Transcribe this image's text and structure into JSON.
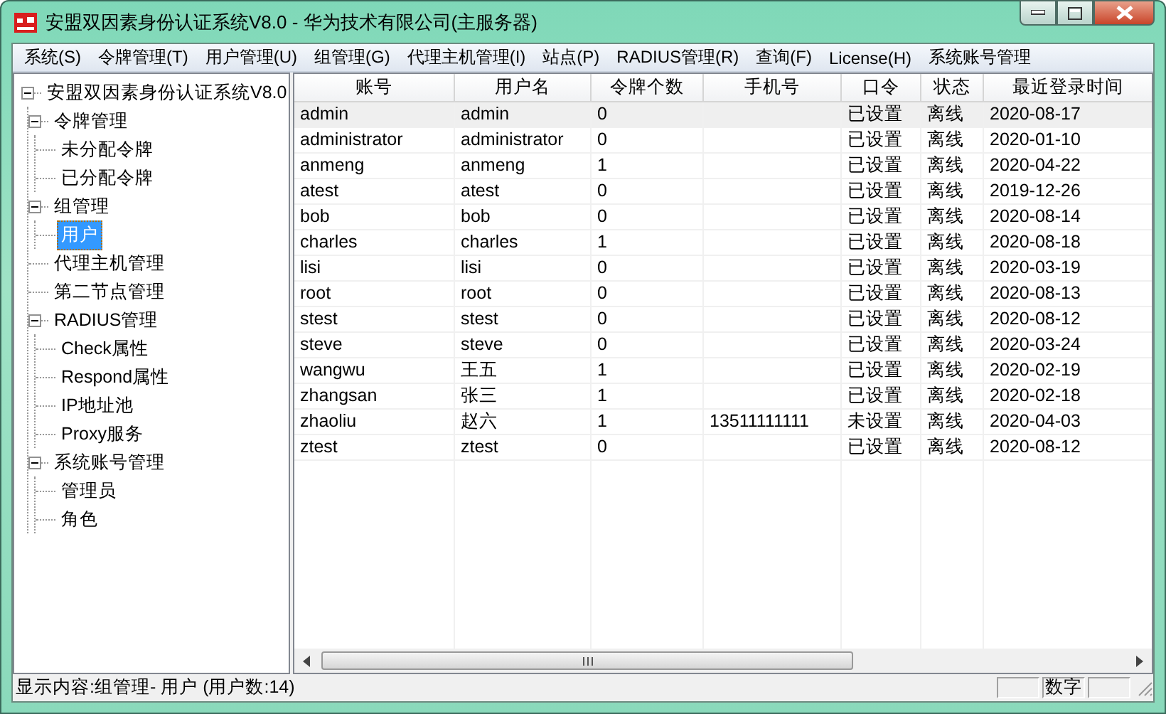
{
  "window": {
    "title": "安盟双因素身份认证系统V8.0 - 华为技术有限公司(主服务器)"
  },
  "menu": [
    "系统(S)",
    "令牌管理(T)",
    "用户管理(U)",
    "组管理(G)",
    "代理主机管理(I)",
    "站点(P)",
    "RADIUS管理(R)",
    "查询(F)",
    "License(H)",
    "系统账号管理"
  ],
  "tree": [
    {
      "label": "安盟双因素身份认证系统V8.0",
      "expanded": true,
      "selected": false,
      "children": [
        {
          "label": "令牌管理",
          "expanded": true,
          "selected": false,
          "children": [
            {
              "label": "未分配令牌",
              "selected": false
            },
            {
              "label": "已分配令牌",
              "selected": false
            }
          ]
        },
        {
          "label": "组管理",
          "expanded": true,
          "selected": false,
          "children": [
            {
              "label": "用户",
              "selected": true
            }
          ]
        },
        {
          "label": "代理主机管理",
          "selected": false
        },
        {
          "label": "第二节点管理",
          "selected": false
        },
        {
          "label": "RADIUS管理",
          "expanded": true,
          "selected": false,
          "children": [
            {
              "label": "Check属性",
              "selected": false
            },
            {
              "label": "Respond属性",
              "selected": false
            },
            {
              "label": "IP地址池",
              "selected": false
            },
            {
              "label": "Proxy服务",
              "selected": false
            }
          ]
        },
        {
          "label": "系统账号管理",
          "expanded": true,
          "selected": false,
          "children": [
            {
              "label": "管理员",
              "selected": false
            },
            {
              "label": "角色",
              "selected": false
            }
          ]
        }
      ]
    }
  ],
  "table": {
    "columns": [
      "账号",
      "用户名",
      "令牌个数",
      "手机号",
      "口令",
      "状态",
      "最近登录时间"
    ],
    "rows": [
      {
        "cells": [
          "admin",
          "admin",
          "0",
          "",
          "已设置",
          "离线",
          "2020-08-17"
        ],
        "selected": true
      },
      {
        "cells": [
          "administrator",
          "administrator",
          "0",
          "",
          "已设置",
          "离线",
          "2020-01-10"
        ],
        "selected": false
      },
      {
        "cells": [
          "anmeng",
          "anmeng",
          "1",
          "",
          "已设置",
          "离线",
          "2020-04-22"
        ],
        "selected": false
      },
      {
        "cells": [
          "atest",
          "atest",
          "0",
          "",
          "已设置",
          "离线",
          "2019-12-26"
        ],
        "selected": false
      },
      {
        "cells": [
          "bob",
          "bob",
          "0",
          "",
          "已设置",
          "离线",
          "2020-08-14"
        ],
        "selected": false
      },
      {
        "cells": [
          "charles",
          "charles",
          "1",
          "",
          "已设置",
          "离线",
          "2020-08-18"
        ],
        "selected": false
      },
      {
        "cells": [
          "lisi",
          "lisi",
          "0",
          "",
          "已设置",
          "离线",
          "2020-03-19"
        ],
        "selected": false
      },
      {
        "cells": [
          "root",
          "root",
          "0",
          "",
          "已设置",
          "离线",
          "2020-08-13"
        ],
        "selected": false
      },
      {
        "cells": [
          "stest",
          "stest",
          "0",
          "",
          "已设置",
          "离线",
          "2020-08-12"
        ],
        "selected": false
      },
      {
        "cells": [
          "steve",
          "steve",
          "0",
          "",
          "已设置",
          "离线",
          "2020-03-24"
        ],
        "selected": false
      },
      {
        "cells": [
          "wangwu",
          "王五",
          "1",
          "",
          "已设置",
          "离线",
          "2020-02-19"
        ],
        "selected": false
      },
      {
        "cells": [
          "zhangsan",
          "张三",
          "1",
          "",
          "已设置",
          "离线",
          "2020-02-18"
        ],
        "selected": false
      },
      {
        "cells": [
          "zhaoliu",
          "赵六",
          "1",
          "13511111111",
          "未设置",
          "离线",
          "2020-04-03"
        ],
        "selected": false
      },
      {
        "cells": [
          "ztest",
          "ztest",
          "0",
          "",
          "已设置",
          "离线",
          "2020-08-12"
        ],
        "selected": false
      }
    ]
  },
  "status_bar": {
    "text": "显示内容:组管理- 用户 (用户数:14)",
    "num_indicator": "数字"
  }
}
